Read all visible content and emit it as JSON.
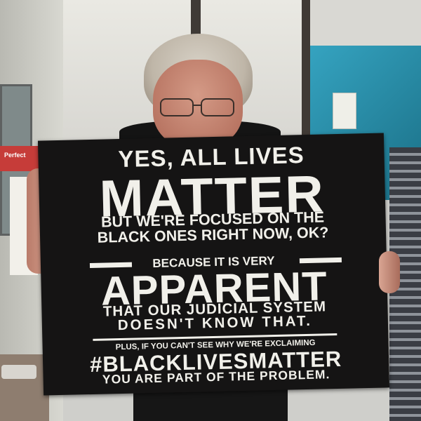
{
  "photo": {
    "background_poster_text": "Perfect",
    "sign": {
      "line1": "YES, ALL LIVES",
      "line2": "MATTER",
      "line3": "BUT WE'RE FOCUSED ON THE",
      "line4": "BLACK ONES RIGHT NOW, OK?",
      "line5": "BECAUSE IT IS VERY",
      "line6": "APPARENT",
      "line7": "THAT OUR JUDICIAL SYSTEM",
      "line8": "DOESN'T KNOW THAT.",
      "line9": "PLUS, IF YOU CAN'T SEE WHY WE'RE EXCLAIMING",
      "line10": "#BLACKLIVESMATTER",
      "line11": "YOU ARE PART OF THE PROBLEM."
    },
    "colors": {
      "sign_background": "#151414",
      "sign_text": "#f1f0ea",
      "blue_wall": "#35a3c0",
      "red_poster": "#c63c39"
    }
  }
}
